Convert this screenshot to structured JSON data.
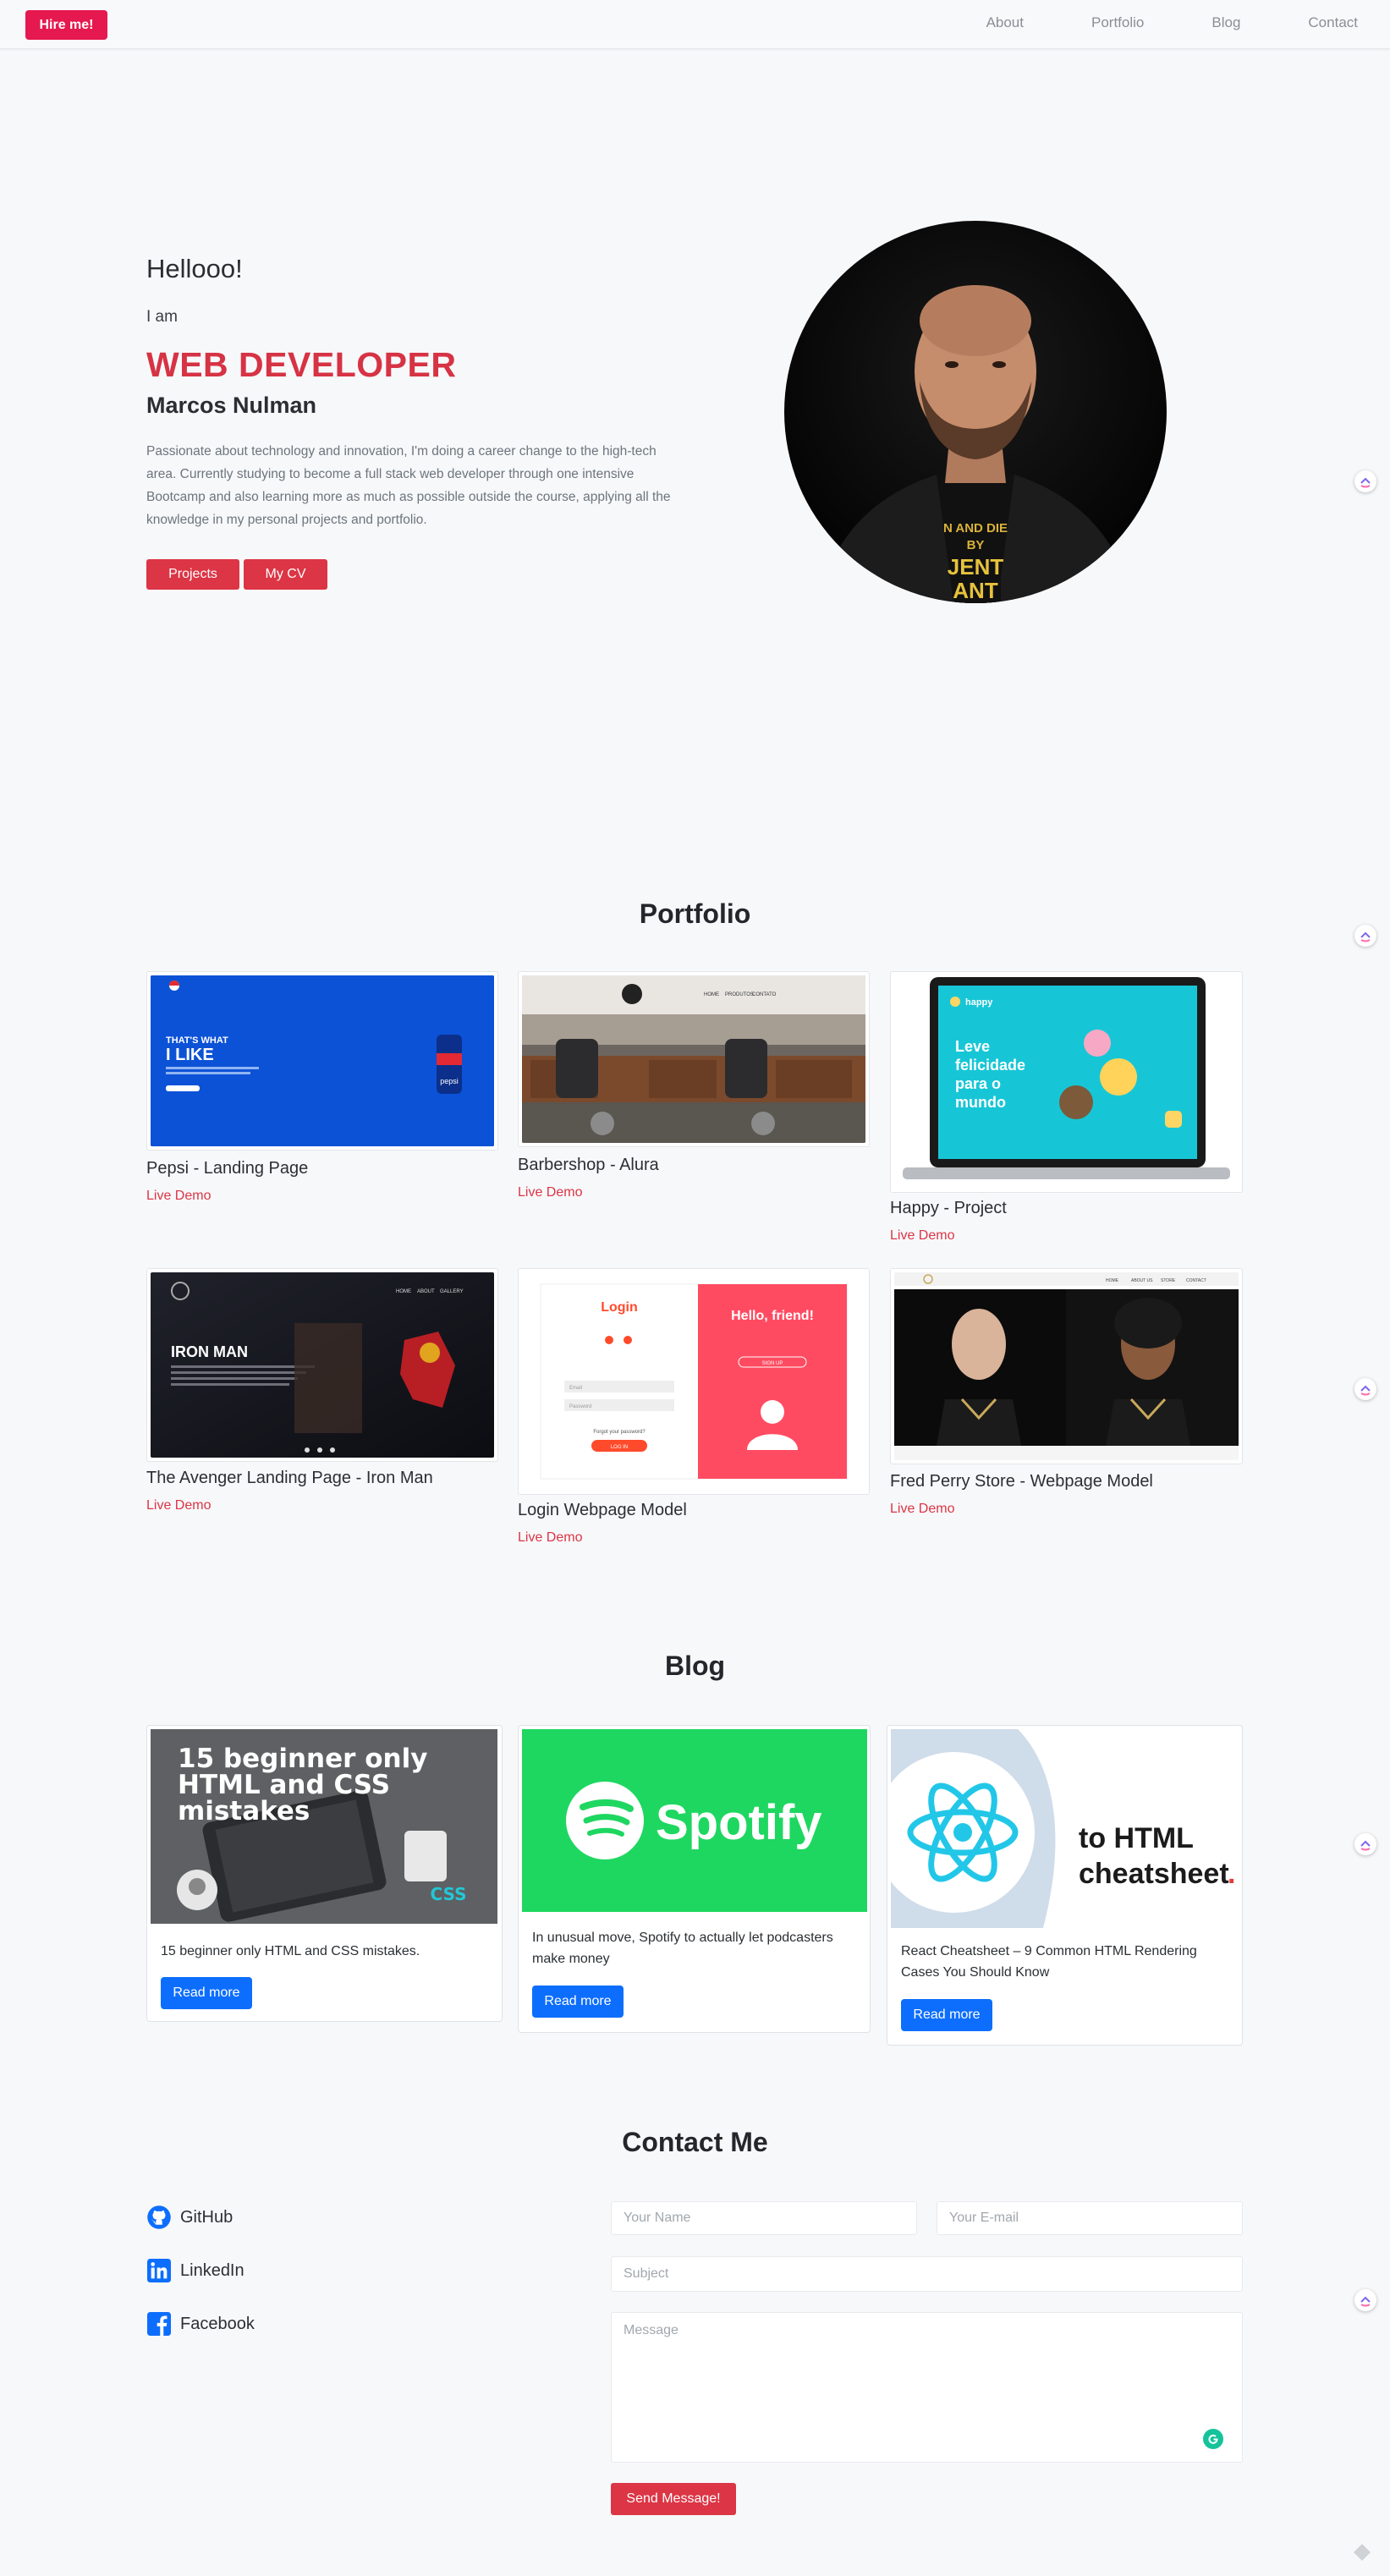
{
  "nav": {
    "hire_label": "Hire me!",
    "links": [
      "About",
      "Portfolio",
      "Blog",
      "Contact"
    ]
  },
  "hero": {
    "greeting": "Hellooo!",
    "i_am": "I am",
    "role": "WEB DEVELOPER",
    "name": "Marcos Nulman",
    "description": "Passionate about technology and innovation, I'm doing a career change to the high-tech area. Currently studying to become a full stack web developer through one intensive Bootcamp and also learning more as much as possible outside the course, applying all the knowledge in my personal projects and portfolio.",
    "projects_label": "Projects",
    "cv_label": "My CV",
    "shirt_text": [
      "N AND DIE",
      "BY",
      "JENT",
      "ANT"
    ]
  },
  "portfolio": {
    "title": "Portfolio",
    "link_label": "Live Demo",
    "items": [
      {
        "title": "Pepsi - Landing Page",
        "thumb_texts": [
          "THAT'S WHAT",
          "I LIKE",
          "pepsi"
        ]
      },
      {
        "title": "Barbershop - Alura",
        "thumb_texts": [
          "HOME",
          "PRODUTOS",
          "CONTATO"
        ]
      },
      {
        "title": "Happy - Project",
        "thumb_texts": [
          "happy",
          "Leve felicidade para o mundo"
        ]
      },
      {
        "title": "The Avenger Landing Page - Iron Man",
        "thumb_texts": [
          "IRON MAN",
          "HOME",
          "ABOUT",
          "GALLERY"
        ]
      },
      {
        "title": "Login Webpage Model",
        "thumb_texts": [
          "Login",
          "Hello, friend!",
          "Email",
          "Password",
          "Forgot your password?",
          "LOG IN",
          "SIGN UP"
        ]
      },
      {
        "title": "Fred Perry Store - Webpage Model",
        "thumb_texts": [
          "HOME",
          "ABOUT US",
          "STORE",
          "CONTACT"
        ]
      }
    ]
  },
  "blog": {
    "title": "Blog",
    "read_more": "Read more",
    "items": [
      {
        "text": "15 beginner only HTML and CSS mistakes.",
        "image_title": "15 beginner only HTML and CSS mistakes",
        "image_badge": "CSS"
      },
      {
        "text": "In unusual move, Spotify to actually let podcasters make money",
        "image_title": "Spotify"
      },
      {
        "text": "React Cheatsheet – 9 Common HTML Rendering Cases You Should Know",
        "image_title": "to HTML cheatsheet."
      }
    ]
  },
  "contact": {
    "title": "Contact Me",
    "socials": [
      "GitHub",
      "LinkedIn",
      "Facebook"
    ],
    "name_placeholder": "Your Name",
    "email_placeholder": "Your E-mail",
    "subject_placeholder": "Subject",
    "message_placeholder": "Message",
    "send_label": "Send Message!"
  },
  "colors": {
    "accent_red": "#dc3545",
    "hire_pink": "#e5194f",
    "blue": "#0d6efd",
    "spotify_green": "#1ed760"
  }
}
